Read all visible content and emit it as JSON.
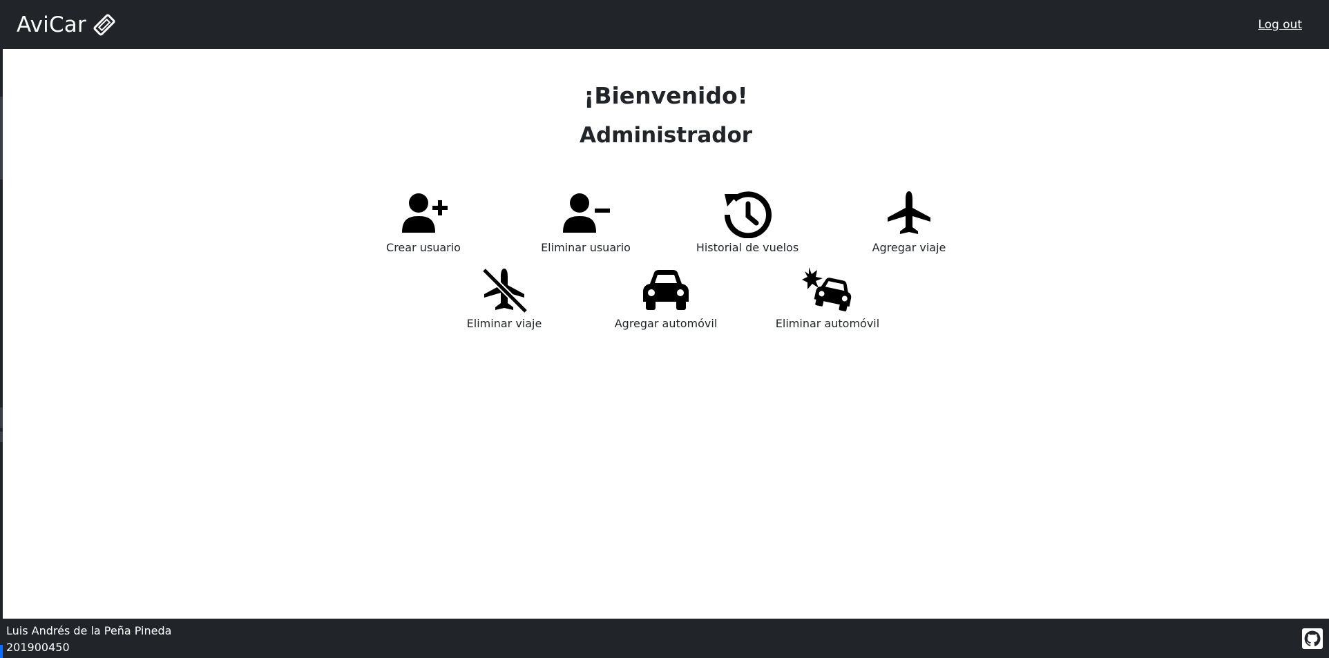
{
  "navbar": {
    "brand": "AviCar",
    "brand_icon": "ticket-icon",
    "logout": "Log out"
  },
  "main": {
    "welcome": "¡Bienvenido!",
    "role": "Administrador",
    "actions": [
      {
        "label": "Crear usuario",
        "icon": "user-plus-icon"
      },
      {
        "label": "Eliminar usuario",
        "icon": "user-minus-icon"
      },
      {
        "label": "Historial de vuelos",
        "icon": "history-icon"
      },
      {
        "label": "Agregar viaje",
        "icon": "plane-icon"
      },
      {
        "label": "Eliminar viaje",
        "icon": "plane-slash-icon"
      },
      {
        "label": "Agregar automóvil",
        "icon": "car-icon"
      },
      {
        "label": "Eliminar automóvil",
        "icon": "car-crash-icon"
      }
    ]
  },
  "footer": {
    "name": "Luis Andrés de la Peña Pineda",
    "id": "201900450",
    "github_icon": "github-icon"
  },
  "colors": {
    "dark": "#212529",
    "text": "#212529",
    "accent": "#0d6efd"
  }
}
